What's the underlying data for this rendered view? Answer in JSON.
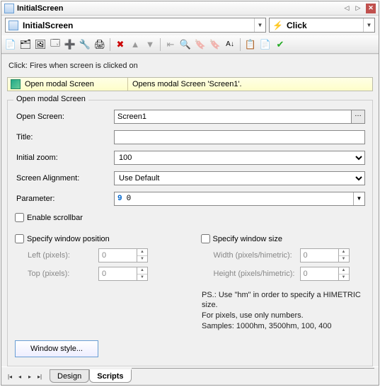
{
  "title": "InitialScreen",
  "combos": {
    "object": "InitialScreen",
    "event": "Click"
  },
  "event_hint": "Click: Fires when screen is clicked on",
  "action": {
    "name": "Open modal Screen",
    "description": "Opens modal Screen 'Screen1'."
  },
  "fieldset_title": "Open modal Screen",
  "labels": {
    "open_screen": "Open Screen:",
    "title": "Title:",
    "initial_zoom": "Initial zoom:",
    "screen_alignment": "Screen Alignment:",
    "parameter": "Parameter:",
    "enable_scrollbar": "Enable scrollbar",
    "specify_pos": "Specify window position",
    "specify_size": "Specify window size",
    "left": "Left (pixels):",
    "top": "Top (pixels):",
    "width": "Width (pixels/himetric):",
    "height": "Height (pixels/himetric):"
  },
  "values": {
    "open_screen": "Screen1",
    "title": "",
    "initial_zoom": "100",
    "screen_alignment": "Use Default",
    "param_index": "9",
    "param_value": "0",
    "left": "0",
    "top": "0",
    "width": "0",
    "height": "0"
  },
  "hint": {
    "l1": "PS.: Use \"hm\" in order to specify a HIMETRIC size.",
    "l2": "For pixels, use only numbers.",
    "l3": "Samples: 1000hm, 3500hm, 100, 400"
  },
  "buttons": {
    "window_style": "Window style..."
  },
  "tabs": {
    "design": "Design",
    "scripts": "Scripts"
  }
}
